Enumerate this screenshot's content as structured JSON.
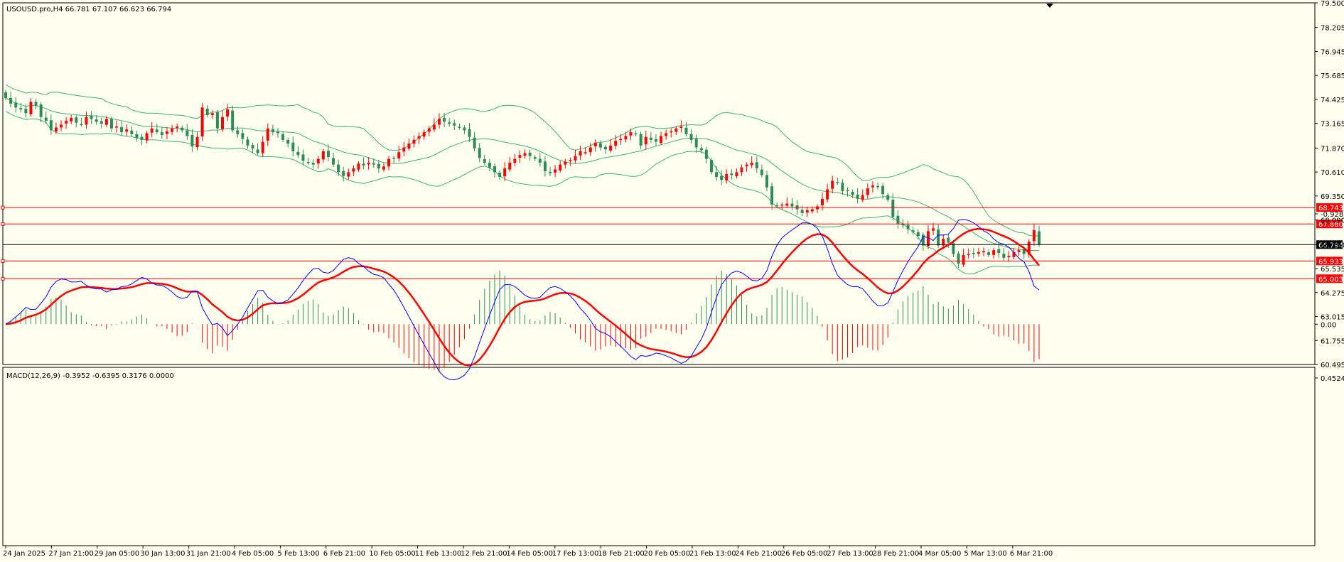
{
  "header": {
    "symbol_line": "USOUSD.pro,H4  66.781 67.107 66.623 66.794"
  },
  "macd": {
    "label": "MACD(12,26,9) -0.3952 -0.6395 0.3176 0.0000",
    "ticks": [
      {
        "label": "0.4524",
        "v": 0.4524
      },
      {
        "label": "0.00",
        "v": 0.0
      },
      {
        "label": "-0.9281",
        "v": -0.9281
      }
    ]
  },
  "colors": {
    "background": "#fffff0",
    "bull": "#ff0000",
    "bear": "#2e8b57",
    "band": "#3cb371",
    "level_line": "#ff0000",
    "current_line": "#000000",
    "macd_signal": "#ff0000",
    "macd_line": "#0000ff",
    "hist_pos": "#ff0000",
    "hist_neg": "#2e8b57"
  },
  "chart_data": {
    "type": "candlestick",
    "ylim": [
      60.495,
      79.5
    ],
    "y_ticks": [
      "79.500",
      "78.205",
      "76.945",
      "75.685",
      "74.425",
      "73.165",
      "71.870",
      "70.610",
      "69.350",
      "68.090",
      "66.794",
      "65.535",
      "64.275",
      "63.015",
      "61.755",
      "60.495"
    ],
    "x_ticks": [
      "24 Jan 2025",
      "27 Jan 21:00",
      "29 Jan 05:00",
      "30 Jan 13:00",
      "31 Jan 21:00",
      "4 Feb 05:00",
      "5 Feb 13:00",
      "6 Feb 21:00",
      "10 Feb 05:00",
      "11 Feb 13:00",
      "12 Feb 21:00",
      "14 Feb 05:00",
      "17 Feb 13:00",
      "18 Feb 21:00",
      "20 Feb 05:00",
      "21 Feb 13:00",
      "24 Feb 21:00",
      "26 Feb 05:00",
      "27 Feb 13:00",
      "28 Feb 21:00",
      "4 Mar 05:00",
      "5 Mar 13:00",
      "6 Mar 21:00"
    ],
    "current_price": {
      "label": "66.794",
      "value": 66.794
    },
    "levels": [
      {
        "label": "68.743",
        "value": 68.743
      },
      {
        "label": "67.880",
        "value": 67.88
      },
      {
        "label": "65.933",
        "value": 65.933
      },
      {
        "label": "65.003",
        "value": 65.003
      }
    ],
    "close": [
      74.5,
      74.2,
      74.0,
      73.9,
      73.7,
      74.3,
      74.1,
      73.5,
      73.3,
      72.8,
      72.95,
      73.1,
      73.3,
      73.45,
      73.2,
      73.1,
      73.5,
      73.4,
      73.25,
      73.15,
      73.4,
      72.9,
      73.0,
      72.7,
      72.85,
      72.6,
      72.4,
      72.3,
      72.65,
      72.9,
      72.7,
      72.55,
      72.75,
      72.9,
      73.0,
      72.8,
      72.5,
      71.95,
      72.45,
      74.0,
      73.6,
      73.7,
      72.9,
      73.5,
      73.9,
      72.8,
      72.6,
      72.35,
      72.0,
      71.85,
      71.6,
      72.2,
      72.9,
      72.7,
      72.65,
      72.3,
      72.1,
      71.7,
      71.5,
      71.2,
      71.1,
      71.0,
      71.3,
      71.7,
      71.4,
      71.0,
      70.6,
      70.4,
      70.6,
      70.8,
      71.05,
      70.95,
      71.1,
      71.0,
      70.8,
      70.9,
      71.3,
      71.35,
      71.65,
      71.9,
      72.1,
      72.3,
      72.5,
      72.7,
      72.9,
      73.1,
      73.4,
      73.25,
      73.15,
      73.05,
      72.95,
      72.8,
      72.45,
      71.85,
      71.35,
      71.1,
      70.85,
      70.6,
      70.35,
      70.8,
      71.1,
      71.3,
      71.5,
      71.6,
      71.45,
      71.3,
      71.1,
      70.65,
      70.55,
      70.75,
      71.0,
      71.15,
      71.25,
      71.45,
      71.7,
      71.65,
      71.9,
      72.15,
      71.9,
      71.8,
      72.0,
      72.25,
      72.35,
      72.5,
      72.7,
      72.6,
      72.0,
      72.45,
      72.3,
      72.2,
      72.5,
      72.65,
      72.75,
      72.9,
      73.0,
      72.6,
      72.3,
      71.9,
      71.75,
      71.3,
      70.6,
      70.35,
      70.2,
      70.5,
      70.45,
      70.6,
      70.85,
      71.0,
      71.1,
      70.8,
      70.45,
      69.8,
      68.9,
      68.85,
      68.9,
      68.95,
      68.8,
      68.65,
      68.45,
      68.6,
      68.65,
      68.8,
      69.2,
      69.7,
      70.15,
      70.05,
      69.6,
      69.6,
      69.4,
      69.2,
      69.4,
      69.75,
      69.9,
      69.85,
      69.45,
      69.15,
      68.25,
      67.9,
      67.8,
      67.6,
      67.45,
      67.25,
      66.75,
      67.5,
      67.65,
      66.75,
      67.1,
      66.9,
      66.3,
      65.8,
      66.25,
      66.3,
      66.35,
      66.4,
      66.45,
      66.25,
      66.5,
      66.35,
      66.1,
      66.2,
      66.4,
      66.5,
      66.3,
      66.95,
      67.55,
      66.794
    ]
  }
}
